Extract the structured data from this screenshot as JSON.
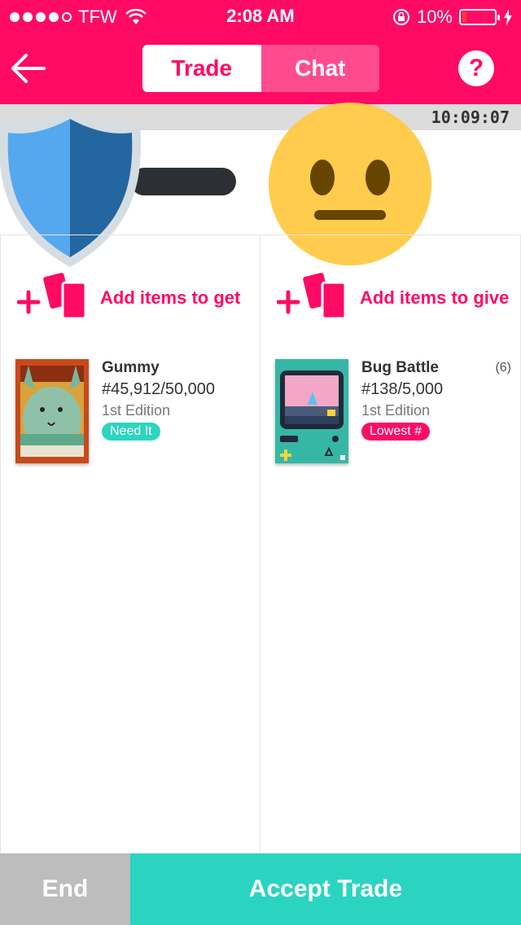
{
  "status_bar": {
    "carrier": "TFW",
    "time": "2:08 AM",
    "battery": "10%"
  },
  "nav": {
    "tabs": [
      {
        "label": "Trade",
        "active": true
      },
      {
        "label": "Chat",
        "active": false
      }
    ],
    "help_label": "?"
  },
  "timer": "10:09:07",
  "colors": {
    "primary": "#FF0A65",
    "accent": "#2BD4C0",
    "end_button": "#BDBDBD"
  },
  "get_column": {
    "add_label": "Add items to get",
    "items": [
      {
        "name": "Gummy",
        "number": "#45,912/50,000",
        "edition": "1st Edition",
        "badge": "Need It"
      }
    ]
  },
  "give_column": {
    "add_label": "Add items to give",
    "items": [
      {
        "name": "Bug Battle",
        "count": "(6)",
        "number": "#138/5,000",
        "edition": "1st Edition",
        "badge": "Lowest #"
      }
    ]
  },
  "actions": {
    "end_label": "End",
    "accept_label": "Accept Trade"
  }
}
